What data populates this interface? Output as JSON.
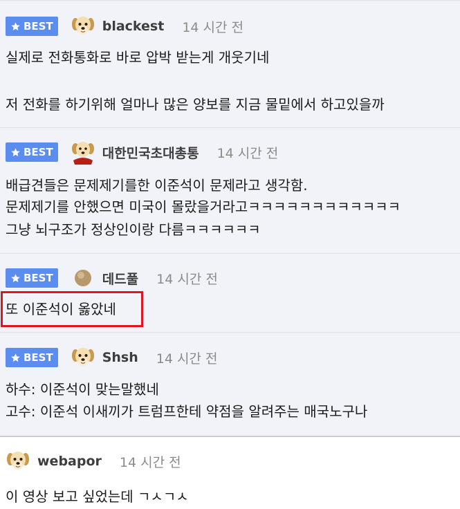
{
  "badge_label": "BEST",
  "comments": [
    {
      "username": "blackest",
      "time": "14 시간 전",
      "avatar": "dog-icon",
      "lines": [
        "실제로 전화통화로 바로 압박 받는게 개웃기네",
        "",
        "저 전화를 하기위해 얼마나 많은 양보를 지금 물밑에서 하고있을까"
      ]
    },
    {
      "username": "대한민국초대총통",
      "time": "14 시간 전",
      "avatar": "dog-caped-icon",
      "lines": [
        "배급견들은 문제제기를한 이준석이 문제라고 생각함.",
        "문제제기를 안했으면 미국이 몰랐을거라고ㅋㅋㅋㅋㅋㅋㅋㅋㅋㅋㅋㅋ",
        "그냥 뇌구조가 정상인이랑 다름ㅋㅋㅋㅋㅋㅋ"
      ]
    },
    {
      "username": "데드풀",
      "time": "14 시간 전",
      "avatar": "ball-avatar-icon",
      "lines": [
        "또 이준석이 옳았네"
      ]
    },
    {
      "username": "Shsh",
      "time": "14 시간 전",
      "avatar": "dog-icon",
      "lines": [
        "하수: 이준석이 맞는말했네",
        "고수: 이준석 이새끼가 트럼프한테 약점을 알려주는 매국노구나"
      ]
    },
    {
      "username": "webapor",
      "time": "14 시간 전",
      "avatar": "dog-icon",
      "lines": [
        "이 영상 보고 싶었는데 ㄱㅅㄱㅅ"
      ]
    }
  ]
}
